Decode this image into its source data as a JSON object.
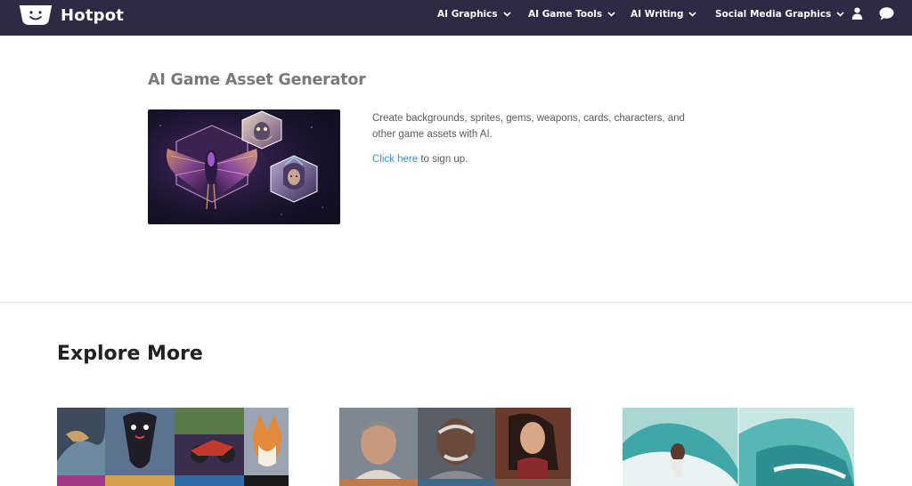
{
  "header": {
    "brand": "Hotpot",
    "logo_icon": "smiling-pot-logo",
    "nav": [
      {
        "label": "AI Graphics",
        "icon": "chevron-down-icon"
      },
      {
        "label": "AI Game Tools",
        "icon": "chevron-down-icon"
      },
      {
        "label": "AI Writing",
        "icon": "chevron-down-icon"
      },
      {
        "label": "Social Media Graphics",
        "icon": "chevron-down-icon"
      }
    ],
    "user_icon": "user-icon",
    "chat_icon": "chat-bubble-icon"
  },
  "hero": {
    "title": "AI Game Asset Generator",
    "description": "Create backgrounds, sprites, gems, weapons, cards, characters, and other game assets with AI.",
    "signup_link": "Click here",
    "signup_suffix": " to sign up."
  },
  "explore": {
    "title": "Explore More"
  },
  "colors": {
    "nav_bg": "#2e2a45",
    "link": "#3e8edc",
    "title_gray": "#7a7a7a"
  }
}
